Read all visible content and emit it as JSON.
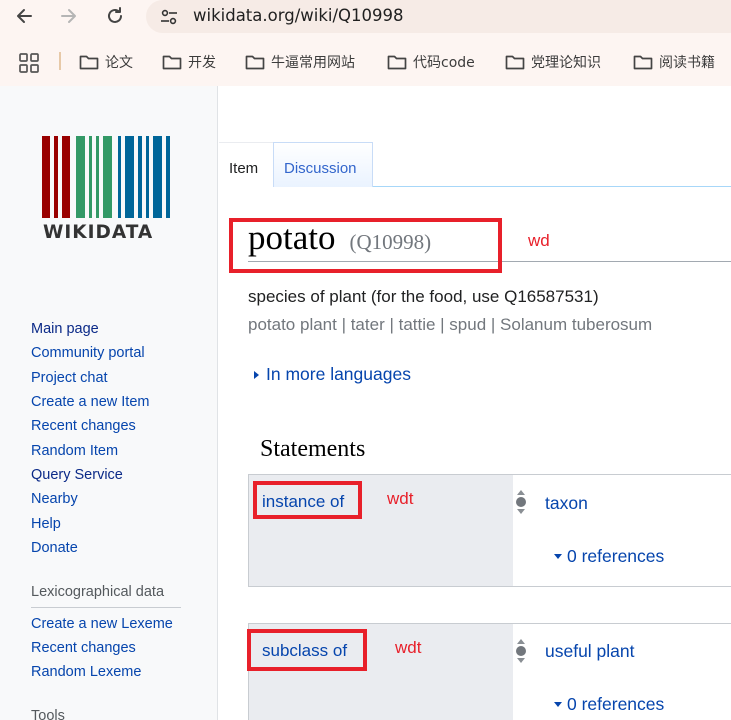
{
  "browser": {
    "url": "wikidata.org/wiki/Q10998",
    "bookmarks": [
      "论文",
      "开发",
      "牛逼常用网站",
      "代码code",
      "党理论知识",
      "阅读书籍"
    ]
  },
  "sidebar": {
    "logo_text": "WIKIDATA",
    "nav_links": [
      "Main page",
      "Community portal",
      "Project chat",
      "Create a new Item",
      "Recent changes",
      "Random Item",
      "Query Service",
      "Nearby",
      "Help",
      "Donate"
    ],
    "lexeme_heading": "Lexicographical data",
    "lexeme_links": [
      "Create a new Lexeme",
      "Recent changes",
      "Random Lexeme"
    ],
    "tools_heading": "Tools"
  },
  "tabs": {
    "item": "Item",
    "discussion": "Discussion"
  },
  "item": {
    "label": "potato",
    "id": "(Q10998)",
    "description": "species of plant (for the food, use Q16587531)",
    "aliases": "potato plant | tater | tattie | spud | Solanum tuberosum",
    "more_languages": "In more languages"
  },
  "statements": {
    "heading": "Statements",
    "list": [
      {
        "property": "instance of",
        "value": "taxon",
        "references": "0 references",
        "annotation": "wdt"
      },
      {
        "property": "subclass of",
        "value": "useful plant",
        "references": "0 references",
        "annotation": "wdt"
      }
    ]
  },
  "annotations": {
    "title_tag": "wd"
  },
  "colors": {
    "link": "#0645ad",
    "annotation": "#e8202a",
    "sidebar_bg": "#f8f9fa",
    "chrome_bg": "#fdf5f2"
  }
}
